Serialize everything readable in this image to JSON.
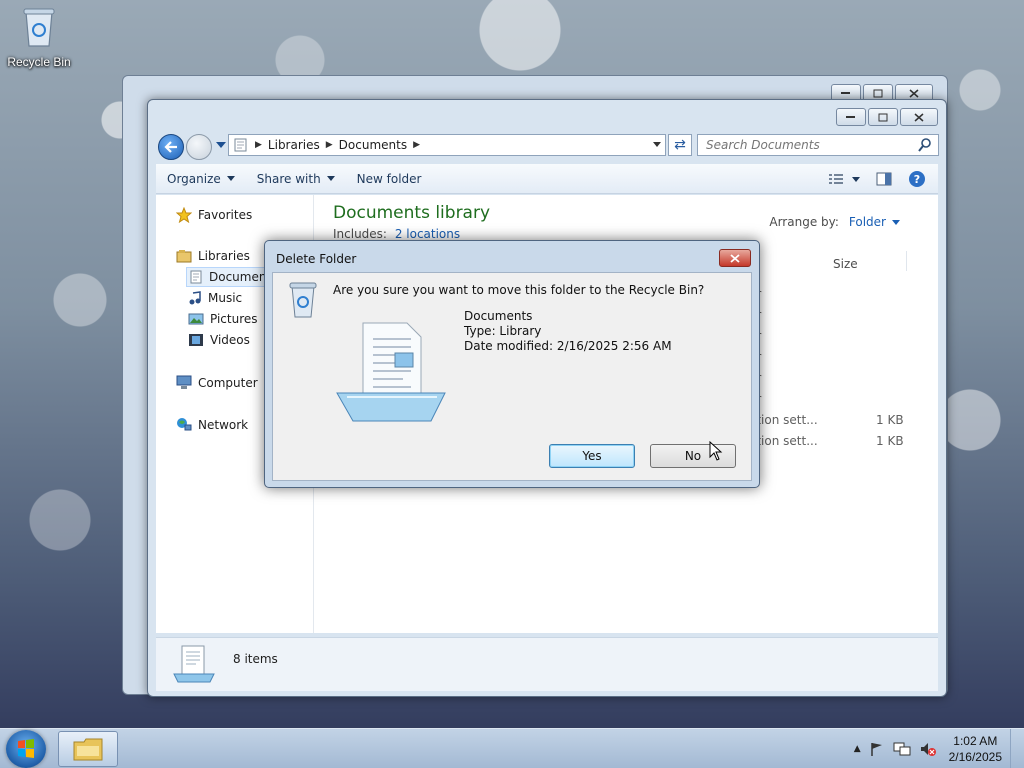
{
  "desktop": {
    "icons": [
      {
        "label": "Recycle Bin",
        "icon": "recycle-bin-icon"
      }
    ]
  },
  "explorer": {
    "address": {
      "segments": [
        "Libraries",
        "Documents"
      ]
    },
    "search": {
      "placeholder": "Search Documents"
    },
    "toolbar": {
      "organize": "Organize",
      "share_with": "Share with",
      "new_folder": "New folder"
    },
    "nav": {
      "favorites": "Favorites",
      "libraries": "Libraries",
      "documents": "Documents",
      "music": "Music",
      "pictures": "Pictures",
      "videos": "Videos",
      "computer": "Computer",
      "network": "Network"
    },
    "library": {
      "title": "Documents library",
      "includes_label": "Includes:",
      "includes_link": "2 locations",
      "arrange_label": "Arrange by:",
      "arrange_value": "Folder"
    },
    "columns": {
      "size": "Size"
    },
    "rows": [
      {
        "type": "er",
        "size": ""
      },
      {
        "type": "er",
        "size": ""
      },
      {
        "type": "er",
        "size": ""
      },
      {
        "type": "er",
        "size": ""
      },
      {
        "type": "er",
        "size": ""
      },
      {
        "type": "er",
        "size": ""
      },
      {
        "type": "ation sett...",
        "size": "1 KB"
      },
      {
        "type": "ation sett...",
        "size": "1 KB"
      }
    ],
    "status": {
      "count": "8 items"
    }
  },
  "dialog": {
    "title": "Delete Folder",
    "question": "Are you sure you want to move this folder to the Recycle Bin?",
    "item_name": "Documents",
    "item_type": "Type: Library",
    "item_modified": "Date modified: 2/16/2025 2:56 AM",
    "yes": "Yes",
    "no": "No"
  },
  "taskbar": {
    "time": "1:02 AM",
    "date": "2/16/2025"
  },
  "colors": {
    "library_title": "#1e6d1e",
    "link": "#1a5fb4",
    "close_button": "#c4382a"
  }
}
